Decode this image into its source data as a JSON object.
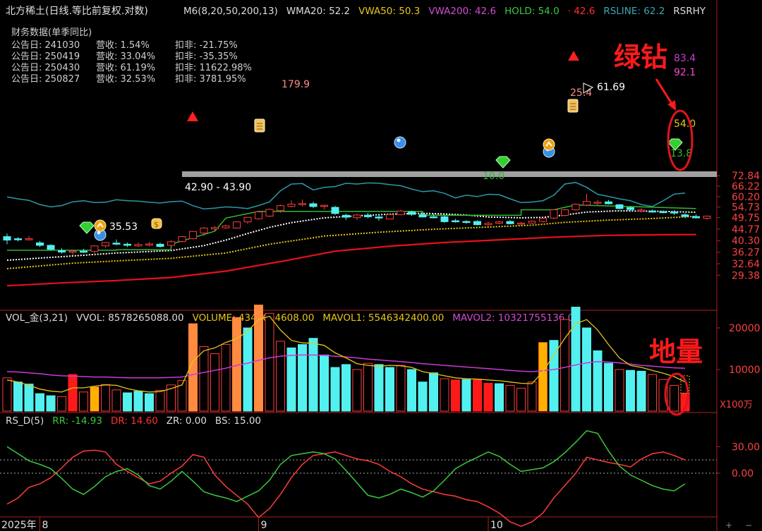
{
  "header": {
    "title": "北方稀土(日线.等比前复权.对数)",
    "indicators": [
      {
        "text": "M6(8,20,50,200,13)",
        "color": "#dddddd"
      },
      {
        "text": "WMA20: 52.2",
        "color": "#dddddd"
      },
      {
        "text": "VWA50: 50.3",
        "color": "#e6c619"
      },
      {
        "text": "VWA200: 42.6",
        "color": "#d24bd2"
      },
      {
        "text": "HOLD: 54.0",
        "color": "#3cc83c"
      },
      {
        "text": "· 42.6",
        "color": "#ff3030"
      },
      {
        "text": "RSLINE: 62.2",
        "color": "#3aa8b0"
      },
      {
        "text": "RSRHY",
        "color": "#dddddd"
      }
    ]
  },
  "finance": {
    "title": "财务数据(单季同比)",
    "rows": [
      {
        "date": "公告日: 241030",
        "rev": "营收:  1.54%",
        "np": "扣非:  -21.75%"
      },
      {
        "date": "公告日: 250419",
        "rev": "营收:  33.04%",
        "np": "扣非:  -35.35%"
      },
      {
        "date": "公告日: 250430",
        "rev": "营收:  61.19%",
        "np": "扣非:  11622.98%"
      },
      {
        "date": "公告日: 250827",
        "rev": "营收:  32.53%",
        "np": "扣非:  3781.95%"
      }
    ]
  },
  "annotations": {
    "green_diamond": "绿钻",
    "ground_volume": "地量",
    "price_labels": [
      "179.9",
      "61.69",
      "25.4",
      "42.90 - 43.90",
      "35.53",
      "10.0",
      "54.0",
      "13.8",
      "83.4",
      "92.1"
    ]
  },
  "volume_header": [
    {
      "text": "VOL_金(3,21)",
      "color": "#dddddd"
    },
    {
      "text": "VVOL: 8578265088.00",
      "color": "#dddddd"
    },
    {
      "text": "VOLUME: 4342084608.00",
      "color": "#e6c619"
    },
    {
      "text": "MAVOL1: 5546342400.00",
      "color": "#e6c619"
    },
    {
      "text": "MAVOL2: 10321755136.00",
      "color": "#d24bd2"
    }
  ],
  "rs_header": [
    {
      "text": "RS_D(5)",
      "color": "#dddddd"
    },
    {
      "text": "RR: -14.93",
      "color": "#3cc83c"
    },
    {
      "text": "DR: 14.60",
      "color": "#ff3030"
    },
    {
      "text": "ZR: 0.00",
      "color": "#dddddd"
    },
    {
      "text": "BS: 15.00",
      "color": "#dddddd"
    }
  ],
  "volume_unit": "X100万",
  "x_axis": [
    {
      "label": "2025年",
      "i": -1
    },
    {
      "label": "8",
      "i": 3
    },
    {
      "label": "9",
      "i": 23
    },
    {
      "label": "10",
      "i": 44
    }
  ],
  "colors": {
    "up": "#ff3b3b",
    "down": "#53f0f0",
    "up_vol_fill": "#000000",
    "white_ma": "#ffffff",
    "vwa50": "#e6c619",
    "vwa200": "#e8101a",
    "hold": "#2fb82f",
    "rsline": "#2a9aa8",
    "mavol1": "#e6c619",
    "mavol2": "#c93ad4",
    "orange_vol": "#ff8a40",
    "gold_vol": "#ffb000",
    "support_line": "#a0a0a0",
    "circle_annot": "#e0141e",
    "axis_text": "#ff4040"
  },
  "chart_data": {
    "type": "candlestick",
    "y_scale": "log",
    "price_ticks": [
      "72.84",
      "66.22",
      "60.20",
      "54.73",
      "49.75",
      "44.77",
      "40.30",
      "36.27",
      "32.64",
      "29.38"
    ],
    "volume_ticks": [
      "20000",
      "10000"
    ],
    "rs_ticks": [
      "30.00",
      "0.00"
    ],
    "ohlc": [
      [
        41.8,
        43.0,
        39.0,
        40.5
      ],
      [
        41.0,
        41.6,
        40.0,
        40.8
      ],
      [
        40.8,
        42.0,
        40.3,
        41.0
      ],
      [
        39.5,
        40.2,
        38.0,
        38.6
      ],
      [
        38.6,
        39.0,
        36.8,
        37.2
      ],
      [
        36.8,
        37.6,
        35.8,
        36.3
      ],
      [
        36.3,
        37.0,
        35.4,
        36.6
      ],
      [
        36.6,
        37.4,
        36.0,
        36.5
      ],
      [
        36.5,
        38.6,
        35.5,
        38.4
      ],
      [
        38.4,
        39.8,
        37.8,
        39.6
      ],
      [
        39.4,
        40.7,
        38.6,
        39.1
      ],
      [
        39.0,
        39.6,
        38.0,
        38.6
      ],
      [
        38.4,
        39.6,
        38.0,
        38.9
      ],
      [
        38.8,
        39.8,
        38.2,
        39.1
      ],
      [
        39.0,
        39.5,
        37.8,
        38.2
      ],
      [
        38.6,
        40.5,
        38.2,
        39.9
      ],
      [
        40.0,
        42.0,
        39.6,
        41.8
      ],
      [
        41.0,
        44.0,
        40.8,
        43.8
      ],
      [
        43.2,
        45.6,
        42.0,
        45.2
      ],
      [
        44.8,
        46.0,
        44.0,
        45.4
      ],
      [
        45.3,
        46.6,
        44.8,
        46.1
      ],
      [
        45.2,
        48.0,
        45.0,
        47.8
      ],
      [
        47.8,
        50.0,
        47.0,
        49.8
      ],
      [
        49.2,
        52.8,
        48.8,
        52.4
      ],
      [
        50.4,
        54.0,
        50.0,
        53.6
      ],
      [
        53.0,
        56.0,
        52.0,
        55.4
      ],
      [
        55.0,
        58.2,
        54.6,
        56.2
      ],
      [
        56.3,
        58.7,
        55.0,
        56.5
      ],
      [
        56.4,
        57.5,
        54.2,
        55.0
      ],
      [
        55.2,
        56.0,
        53.5,
        55.6
      ],
      [
        54.6,
        55.3,
        51.0,
        51.6
      ],
      [
        50.8,
        51.5,
        48.7,
        49.9
      ],
      [
        49.7,
        51.5,
        48.6,
        50.9
      ],
      [
        50.8,
        51.9,
        49.5,
        50.1
      ],
      [
        50.0,
        51.0,
        48.3,
        49.9
      ],
      [
        49.1,
        51.5,
        48.9,
        51.1
      ],
      [
        51.1,
        53.4,
        50.8,
        52.8
      ],
      [
        52.3,
        53.0,
        50.5,
        51.2
      ],
      [
        51.1,
        52.0,
        49.8,
        50.0
      ],
      [
        50.1,
        51.4,
        49.5,
        49.9
      ],
      [
        50.1,
        50.6,
        47.4,
        47.9
      ],
      [
        48.3,
        49.2,
        47.5,
        48.2
      ],
      [
        48.0,
        48.5,
        47.0,
        47.8
      ],
      [
        48.0,
        48.5,
        46.3,
        46.6
      ],
      [
        46.6,
        48.0,
        46.0,
        47.2
      ],
      [
        47.2,
        48.2,
        46.8,
        47.8
      ],
      [
        48.0,
        48.6,
        46.8,
        47.0
      ],
      [
        47.0,
        47.8,
        46.4,
        47.3
      ],
      [
        47.3,
        48.5,
        47.0,
        48.1
      ],
      [
        48.0,
        49.6,
        47.6,
        49.4
      ],
      [
        49.5,
        53.7,
        49.0,
        53.4
      ],
      [
        50.7,
        53.8,
        50.3,
        53.4
      ],
      [
        53.4,
        56.5,
        53.0,
        56.2
      ],
      [
        55.7,
        61.7,
        55.3,
        57.6
      ],
      [
        56.8,
        58.3,
        55.6,
        57.2
      ],
      [
        57.4,
        58.4,
        56.0,
        56.4
      ],
      [
        55.9,
        56.3,
        53.6,
        54.0
      ],
      [
        54.5,
        55.0,
        52.7,
        53.5
      ],
      [
        53.0,
        54.2,
        52.8,
        53.3
      ],
      [
        52.8,
        53.5,
        52.0,
        52.5
      ],
      [
        52.5,
        53.0,
        51.7,
        52.2
      ],
      [
        52.3,
        53.2,
        51.0,
        52.0
      ],
      [
        51.0,
        51.8,
        49.5,
        50.2
      ],
      [
        50.2,
        51.2,
        49.3,
        49.6
      ],
      [
        49.4,
        50.6,
        48.8,
        50.4
      ]
    ],
    "volume": [
      [
        8000,
        0
      ],
      [
        7000,
        1
      ],
      [
        6500,
        1
      ],
      [
        4200,
        1
      ],
      [
        3700,
        1
      ],
      [
        3500,
        0
      ],
      [
        8800,
        2
      ],
      [
        4600,
        0
      ],
      [
        5800,
        0
      ],
      [
        6400,
        0
      ],
      [
        5100,
        0
      ],
      [
        4400,
        1
      ],
      [
        4800,
        1
      ],
      [
        4200,
        1
      ],
      [
        5000,
        0
      ],
      [
        6300,
        0
      ],
      [
        7400,
        0
      ],
      [
        21000,
        3
      ],
      [
        15500,
        0
      ],
      [
        13800,
        0
      ],
      [
        16000,
        0
      ],
      [
        22500,
        3
      ],
      [
        20000,
        1
      ],
      [
        25500,
        3
      ],
      [
        23500,
        0
      ],
      [
        16800,
        0
      ],
      [
        15200,
        1
      ],
      [
        16000,
        1
      ],
      [
        17500,
        1
      ],
      [
        13500,
        1
      ],
      [
        10500,
        1
      ],
      [
        11200,
        1
      ],
      [
        10000,
        0
      ],
      [
        11500,
        0
      ],
      [
        11200,
        1
      ],
      [
        10500,
        1
      ],
      [
        11000,
        0
      ],
      [
        10000,
        1
      ],
      [
        7000,
        1
      ],
      [
        9200,
        1
      ],
      [
        7800,
        0
      ],
      [
        7500,
        2
      ],
      [
        7600,
        1
      ],
      [
        7700,
        2
      ],
      [
        6700,
        2
      ],
      [
        6600,
        1
      ],
      [
        6200,
        0
      ],
      [
        5500,
        0
      ],
      [
        7000,
        0
      ],
      [
        16500,
        2
      ],
      [
        17000,
        1
      ],
      [
        22000,
        0
      ],
      [
        25000,
        1
      ],
      [
        20000,
        1
      ],
      [
        14500,
        1
      ],
      [
        11500,
        1
      ],
      [
        10000,
        0
      ],
      [
        9800,
        1
      ],
      [
        9600,
        1
      ],
      [
        8800,
        0
      ],
      [
        7600,
        0
      ],
      [
        6200,
        0
      ],
      [
        4300,
        2
      ]
    ],
    "mavol1": [
      7500,
      7000,
      6200,
      5300,
      4800,
      4600,
      5600,
      5600,
      6000,
      6300,
      6200,
      5400,
      4900,
      4600,
      4700,
      5400,
      6300,
      12000,
      14500,
      15200,
      16500,
      17400,
      19200,
      22000,
      22800,
      19500,
      17000,
      16400,
      16300,
      15800,
      14000,
      12800,
      11400,
      11000,
      10800,
      11000,
      10900,
      10500,
      9500,
      9000,
      8500,
      8000,
      7800,
      7700,
      7500,
      7300,
      7000,
      6700,
      6600,
      9500,
      13500,
      17500,
      21000,
      22000,
      19500,
      16000,
      12800,
      11000,
      10500,
      9800,
      9100,
      8300,
      7000
    ],
    "mavol2": [
      9500,
      9400,
      9200,
      9000,
      8700,
      8500,
      8400,
      8300,
      8200,
      8200,
      8100,
      8000,
      8000,
      8000,
      8000,
      8100,
      8200,
      8800,
      9300,
      9800,
      10300,
      11000,
      11500,
      12200,
      12800,
      13200,
      13400,
      13500,
      13500,
      13400,
      13200,
      13000,
      12800,
      12500,
      12300,
      12100,
      11900,
      11700,
      11400,
      11200,
      11000,
      10800,
      10600,
      10400,
      10200,
      10000,
      9800,
      9600,
      9500,
      9700,
      10000,
      10500,
      11100,
      11600,
      11900,
      11800,
      11600,
      11300,
      11000,
      10800,
      10600,
      10400,
      10300
    ],
    "rr": [
      30,
      22,
      14,
      10,
      5,
      -6,
      -18,
      -24,
      -15,
      -4,
      2,
      5,
      -2,
      -14,
      -18,
      -9,
      2,
      -9,
      -21,
      -25,
      -28,
      -32,
      -26,
      -20,
      -8,
      10,
      20,
      22,
      24,
      22,
      16,
      3,
      -11,
      -25,
      -28,
      -24,
      -18,
      -22,
      -27,
      -20,
      -8,
      5,
      12,
      18,
      24,
      19,
      10,
      2,
      4,
      6,
      13,
      23,
      35,
      48,
      45,
      25,
      8,
      -2,
      -8,
      -14,
      -18,
      -20,
      -12
    ],
    "dr": [
      -35,
      -28,
      -16,
      -12,
      -5,
      6,
      18,
      25,
      26,
      24,
      10,
      2,
      -5,
      -12,
      -9,
      0,
      8,
      21,
      18,
      -2,
      -15,
      -25,
      -35,
      -50,
      -40,
      -24,
      -5,
      10,
      20,
      22,
      24,
      20,
      16,
      14,
      10,
      2,
      -4,
      -12,
      -18,
      -21,
      -24,
      -26,
      -30,
      -32,
      -38,
      -45,
      -55,
      -60,
      -55,
      -45,
      -28,
      -14,
      0,
      18,
      15,
      12,
      10,
      7,
      16,
      22,
      24,
      20,
      15
    ],
    "rsline": [
      60.0,
      59.0,
      58.2,
      56.0,
      54.8,
      55.5,
      57.4,
      58.0,
      57.0,
      57.2,
      58.5,
      58.0,
      57.8,
      57.2,
      56.8,
      57.5,
      57.8,
      55.4,
      53.8,
      54.2,
      54.8,
      54.5,
      54.0,
      55.5,
      57.4,
      63.5,
      67.5,
      67.8,
      64.0,
      65.5,
      66.0,
      68.0,
      67.5,
      68.2,
      68.0,
      67.2,
      66.5,
      64.5,
      63.0,
      63.5,
      62.0,
      59.5,
      61.0,
      60.2,
      61.5,
      61.3,
      59.0,
      57.0,
      57.3,
      58.0,
      61.0,
      67.5,
      68.5,
      65.5,
      61.5,
      60.3,
      59.0,
      58.0,
      56.0,
      55.0,
      58.0,
      61.6,
      62.2
    ],
    "hold": [
      [
        0,
        36.9
      ],
      [
        10,
        36.9
      ],
      [
        10,
        37.1
      ],
      [
        15,
        37.1
      ],
      [
        15,
        39.0
      ],
      [
        19,
        43.9
      ],
      [
        20,
        49.5
      ],
      [
        23,
        52.6
      ],
      [
        38,
        52.6
      ],
      [
        38,
        50.8
      ],
      [
        47,
        50.8
      ],
      [
        47,
        53.4
      ],
      [
        50,
        53.4
      ],
      [
        51,
        54.6
      ],
      [
        52,
        55.8
      ],
      [
        63,
        54.0
      ]
    ],
    "vwa50": [
      [
        0,
        31.2
      ],
      [
        6,
        32.8
      ],
      [
        10,
        33.5
      ],
      [
        15,
        34.3
      ],
      [
        20,
        36.0
      ],
      [
        24,
        39.0
      ],
      [
        29,
        42.0
      ],
      [
        34,
        43.5
      ],
      [
        39,
        44.7
      ],
      [
        44,
        45.6
      ],
      [
        48,
        46.4
      ],
      [
        51,
        47.6
      ],
      [
        55,
        48.6
      ],
      [
        59,
        49.3
      ],
      [
        63,
        50.3
      ]
    ],
    "vwa200": [
      [
        0,
        26.7
      ],
      [
        5,
        27.4
      ],
      [
        10,
        28.0
      ],
      [
        15,
        28.8
      ],
      [
        20,
        30.5
      ],
      [
        25,
        33.3
      ],
      [
        30,
        36.6
      ],
      [
        35,
        38.3
      ],
      [
        40,
        39.6
      ],
      [
        45,
        40.6
      ],
      [
        50,
        41.6
      ],
      [
        55,
        42.3
      ],
      [
        59,
        42.5
      ],
      [
        63,
        42.6
      ]
    ],
    "wma20": [
      [
        0,
        33.7
      ],
      [
        5,
        34.8
      ],
      [
        10,
        36.0
      ],
      [
        15,
        36.8
      ],
      [
        18,
        38.5
      ],
      [
        20,
        40.5
      ],
      [
        22,
        43.0
      ],
      [
        24,
        45.5
      ],
      [
        26,
        47.5
      ],
      [
        29,
        49.6
      ],
      [
        32,
        50.5
      ],
      [
        35,
        51.3
      ],
      [
        38,
        51.7
      ],
      [
        40,
        51.4
      ],
      [
        42,
        50.9
      ],
      [
        44,
        50.0
      ],
      [
        47,
        49.6
      ],
      [
        49,
        49.8
      ],
      [
        51,
        50.9
      ],
      [
        53,
        52.3
      ],
      [
        56,
        52.9
      ],
      [
        60,
        52.6
      ],
      [
        63,
        52.2
      ]
    ]
  }
}
